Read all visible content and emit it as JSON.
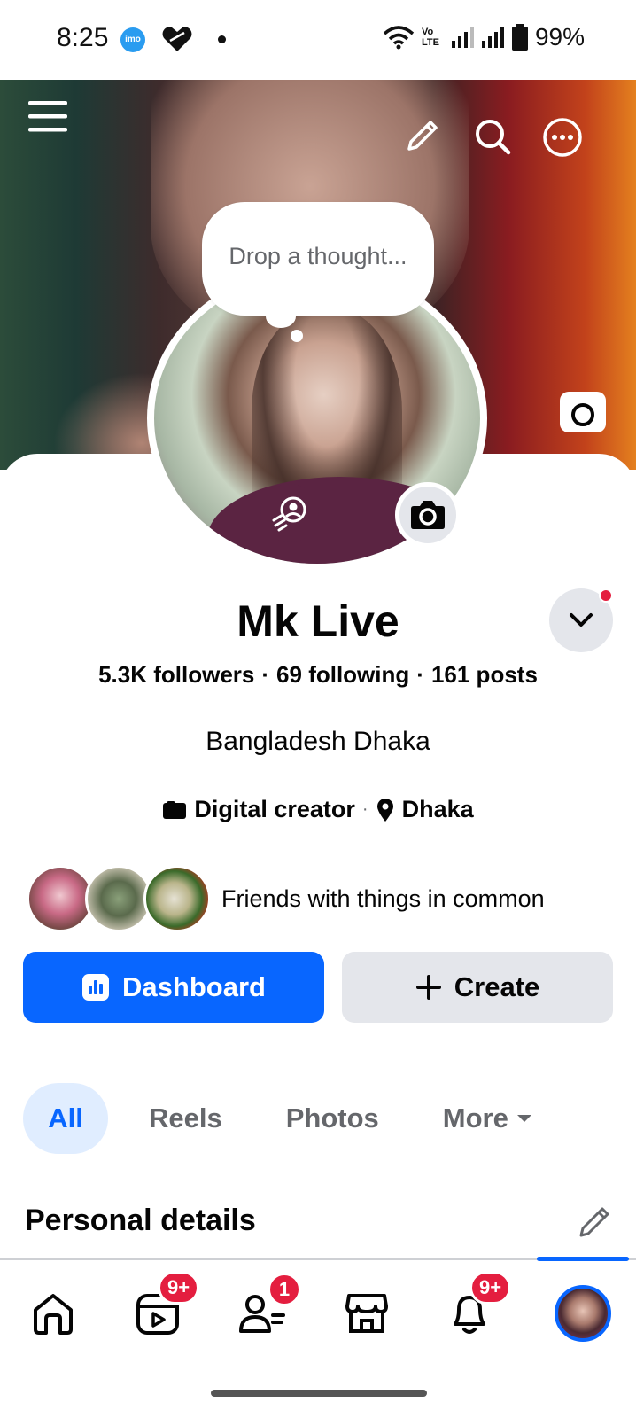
{
  "status_bar": {
    "time": "8:25",
    "imo_label": "imo",
    "battery": "99%",
    "volte": "Vo LTE"
  },
  "header": {
    "thought_placeholder": "Drop a thought..."
  },
  "profile": {
    "name": "Mk Live",
    "followers": "5.3K followers",
    "following": "69 following",
    "posts": "161 posts",
    "bio": "Bangladesh Dhaka",
    "category": "Digital creator",
    "location": "Dhaka",
    "friends_text": "Friends with things in common"
  },
  "actions": {
    "dashboard_label": "Dashboard",
    "create_label": "Create"
  },
  "tabs": [
    {
      "label": "All",
      "active": true
    },
    {
      "label": "Reels",
      "active": false
    },
    {
      "label": "Photos",
      "active": false
    },
    {
      "label": "More",
      "active": false
    }
  ],
  "section": {
    "personal_details": "Personal details"
  },
  "bottom_nav": {
    "video_badge": "9+",
    "friends_badge": "1",
    "notifications_badge": "9+"
  },
  "colors": {
    "accent": "#0866ff",
    "badge": "#e41e3f",
    "secondary_button": "#e4e6eb",
    "muted_text": "#65676b"
  },
  "icons": [
    "menu-icon",
    "edit-icon",
    "search-icon",
    "more-icon",
    "camera-icon",
    "avatar-frame-icon",
    "chevron-down-icon",
    "briefcase-icon",
    "location-pin-icon",
    "dashboard-icon",
    "plus-icon",
    "caret-down-icon",
    "home-icon",
    "video-icon",
    "friends-icon",
    "marketplace-icon",
    "bell-icon"
  ]
}
